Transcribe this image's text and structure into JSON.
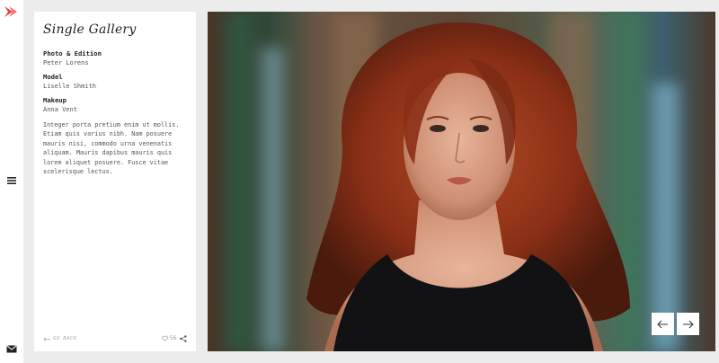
{
  "gallery": {
    "title": "Single Gallery",
    "credits": [
      {
        "role": "Photo & Edition",
        "name": "Peter Lorens"
      },
      {
        "role": "Model",
        "name": "Liselle Shmith"
      },
      {
        "role": "Makeup",
        "name": "Anna Vent"
      }
    ],
    "description": "Integer porta pretium enim ut mollis. Etiam quis varius nibh. Nam posuere mauris nisi, commodo urna venenatis aliquam. Mauris dapibus mauris quis lorem aliquet posuere. Fusce vitae scelerisque lectus.",
    "go_back_label": "GO BACK",
    "likes_count": "56"
  },
  "colors": {
    "brand": "#e8453c",
    "panel_bg": "#ffffff",
    "page_bg": "#ececec"
  },
  "icons": {
    "logo": "arrow-logo-icon",
    "menu": "hamburger-menu-icon",
    "mail": "mail-icon",
    "back": "arrow-left-icon",
    "like": "heart-icon",
    "share": "share-icon",
    "prev": "arrow-left-icon",
    "next": "arrow-right-icon"
  }
}
